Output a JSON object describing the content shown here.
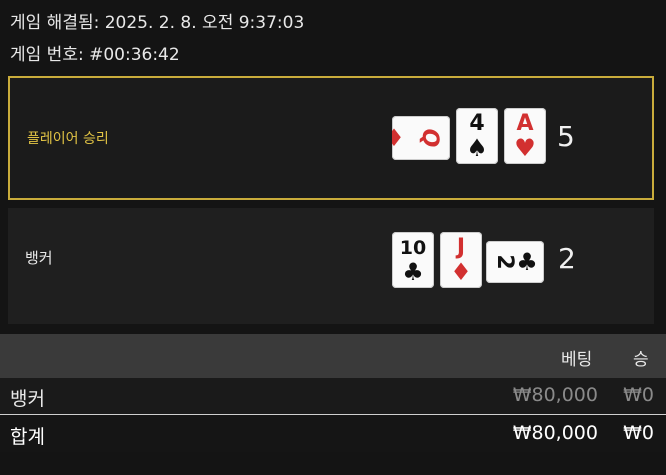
{
  "header": {
    "resolved_line": "게임 해결됨: 2025. 2. 8. 오전 9:37:03",
    "game_number_line": "게임 번호: #00:36:42"
  },
  "player": {
    "label": "플레이어 승리",
    "score": "5",
    "cards": [
      {
        "rank": "Q",
        "suit": "♦",
        "color": "red",
        "rotated": true
      },
      {
        "rank": "4",
        "suit": "♠",
        "color": "black",
        "rotated": false
      },
      {
        "rank": "A",
        "suit": "♥",
        "color": "red",
        "rotated": false
      }
    ]
  },
  "banker": {
    "label": "뱅커",
    "score": "2",
    "cards": [
      {
        "rank": "10",
        "suit": "♣",
        "color": "black",
        "rotated": false
      },
      {
        "rank": "J",
        "suit": "♦",
        "color": "red",
        "rotated": false
      },
      {
        "rank": "2",
        "suit": "♣",
        "color": "black",
        "rotated": true
      }
    ]
  },
  "table": {
    "headers": {
      "bet": "베팅",
      "win": "승"
    },
    "rows": [
      {
        "label": "뱅커",
        "bet": "₩80,000",
        "win": "₩0"
      },
      {
        "label": "합계",
        "bet": "₩80,000",
        "win": "₩0"
      }
    ]
  },
  "colors": {
    "player_highlight": "#c9ac3b",
    "red_suit": "#d23030"
  }
}
